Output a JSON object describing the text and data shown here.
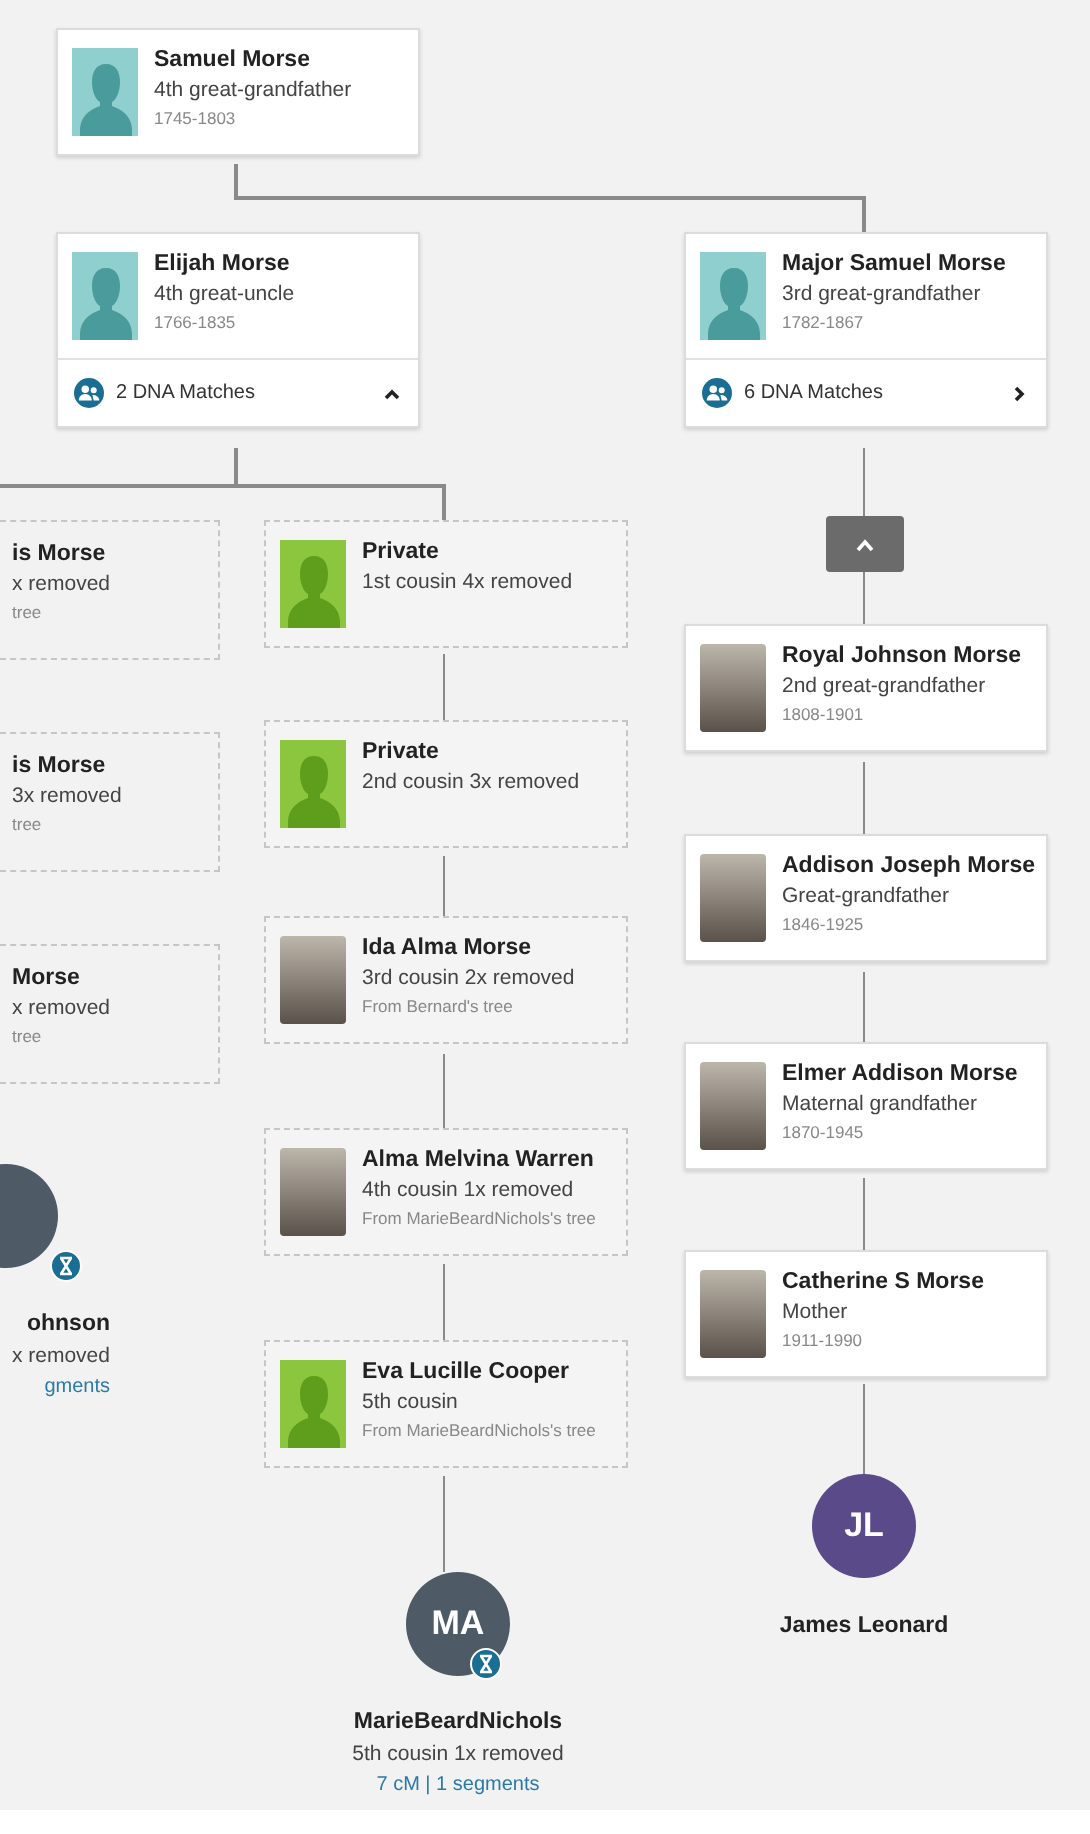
{
  "top_ancestor": {
    "name": "Samuel Morse",
    "relation": "4th great-grandfather",
    "dates": "1745-1803",
    "kind": "ancestor"
  },
  "branches": [
    {
      "name": "Elijah Morse",
      "relation": "4th great-uncle",
      "dates": "1766-1835",
      "kind": "ancestor",
      "dna_matches": {
        "label": "2 DNA Matches",
        "expanded": true
      }
    },
    {
      "name": "Major Samuel Morse",
      "relation": "3rd great-grandfather",
      "dates": "1782-1867",
      "kind": "ancestor",
      "dna_matches": {
        "label": "6 DNA Matches",
        "expanded": false
      }
    }
  ],
  "left_column_cards": [
    {
      "name": "is Morse",
      "relation": "x removed",
      "source": "tree"
    },
    {
      "name": "is Morse",
      "relation": "3x removed",
      "source": "tree"
    },
    {
      "name": "Morse",
      "relation": "x removed",
      "source": "tree"
    }
  ],
  "middle_column_cards": [
    {
      "name": "Private",
      "relation": "1st cousin 4x removed",
      "kind": "private"
    },
    {
      "name": "Private",
      "relation": "2nd cousin 3x removed",
      "kind": "private"
    },
    {
      "name": "Ida Alma Morse",
      "relation": "3rd cousin 2x removed",
      "source": "From Bernard's tree",
      "kind": "photo"
    },
    {
      "name": "Alma Melvina Warren",
      "relation": "4th cousin 1x removed",
      "source": "From MarieBeardNichols's tree",
      "kind": "photo"
    },
    {
      "name": "Eva Lucille Cooper",
      "relation": "5th cousin",
      "source": "From MarieBeardNichols's tree",
      "kind": "private"
    }
  ],
  "collapse_button": {
    "expanded": true
  },
  "right_column_cards": [
    {
      "name": "Royal Johnson Morse",
      "relation": "2nd great-grandfather",
      "dates": "1808-1901",
      "kind": "photo"
    },
    {
      "name": "Addison Joseph Morse",
      "relation": "Great-grandfather",
      "dates": "1846-1925",
      "kind": "photo"
    },
    {
      "name": "Elmer Addison Morse",
      "relation": "Maternal grandfather",
      "dates": "1870-1945",
      "kind": "photo"
    },
    {
      "name": "Catherine S Morse",
      "relation": "Mother",
      "dates": "1911-1990",
      "kind": "photo"
    }
  ],
  "matches": [
    {
      "name": "ohnson",
      "relation": "x removed",
      "details": "gments"
    },
    {
      "initials": "MA",
      "name": "MarieBeardNichols",
      "relation": "5th cousin 1x removed",
      "details": "7 cM | 1 segments"
    }
  ],
  "home_person": {
    "initials": "JL",
    "name": "James Leonard"
  }
}
